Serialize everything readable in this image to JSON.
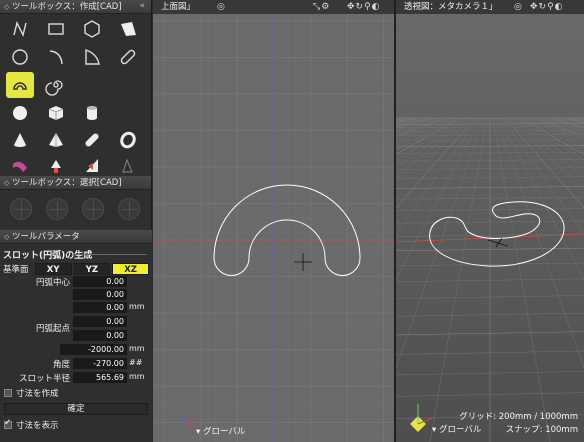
{
  "toolbox_create": {
    "title": "ツールボックス：作成[CAD]",
    "collapse": "«"
  },
  "toolbox_select": {
    "title": "ツールボックス：選択[CAD]"
  },
  "tool_parameters": {
    "title": "ツールパラメータ",
    "section": "スロット(円弧)の生成",
    "plane_label": "基準面",
    "planes": [
      "XY",
      "YZ",
      "XZ"
    ],
    "selected_plane": "XZ",
    "arc_center_label": "円弧中心",
    "arc_center": [
      "0.00",
      "0.00",
      "0.00"
    ],
    "arc_start_label": "円弧起点",
    "arc_start": [
      "0.00",
      "0.00",
      "-2000.00"
    ],
    "unit_mm": "mm",
    "angle_label": "角度",
    "angle": "-270.00",
    "angle_unit": "##",
    "slot_radius_label": "スロット半径",
    "slot_radius": "565.69",
    "create_dimensions": "寸法を作成",
    "create_dimensions_checked": false,
    "confirm": "確定",
    "show_dimensions": "寸法を表示",
    "show_dimensions_checked": true
  },
  "viewport_top": {
    "title": "上面図」",
    "axis_mode": "グローバル"
  },
  "viewport_persp": {
    "title": "透視図：メタカメラ１」",
    "axis_mode": "グローバル",
    "grid_label": "グリッド: 200mm / 1000mm",
    "snap_label": "スナップ: 100mm"
  },
  "icons": {
    "tools_create": [
      "polyline-icon",
      "rectangle-icon",
      "polygon-icon",
      "free-polygon-icon",
      "circle-icon",
      "arc-icon",
      "curve-corner-icon",
      "slot-icon",
      "arc-slot-icon",
      "spiral-icon",
      "sphere-icon",
      "cube-icon",
      "cylinder-icon",
      "cone-icon",
      "pyramid-icon",
      "capsule-icon",
      "ring-icon",
      "torus-knot-icon",
      "arrow-up-icon",
      "wedge-icon",
      "extra-icon"
    ],
    "active_tool": "arc-slot-icon"
  },
  "colors": {
    "accent": "#efef2e",
    "grid_major": "#7e7e7e",
    "axis_red": "#c84b4b",
    "axis_blue": "#5b5bd6"
  }
}
